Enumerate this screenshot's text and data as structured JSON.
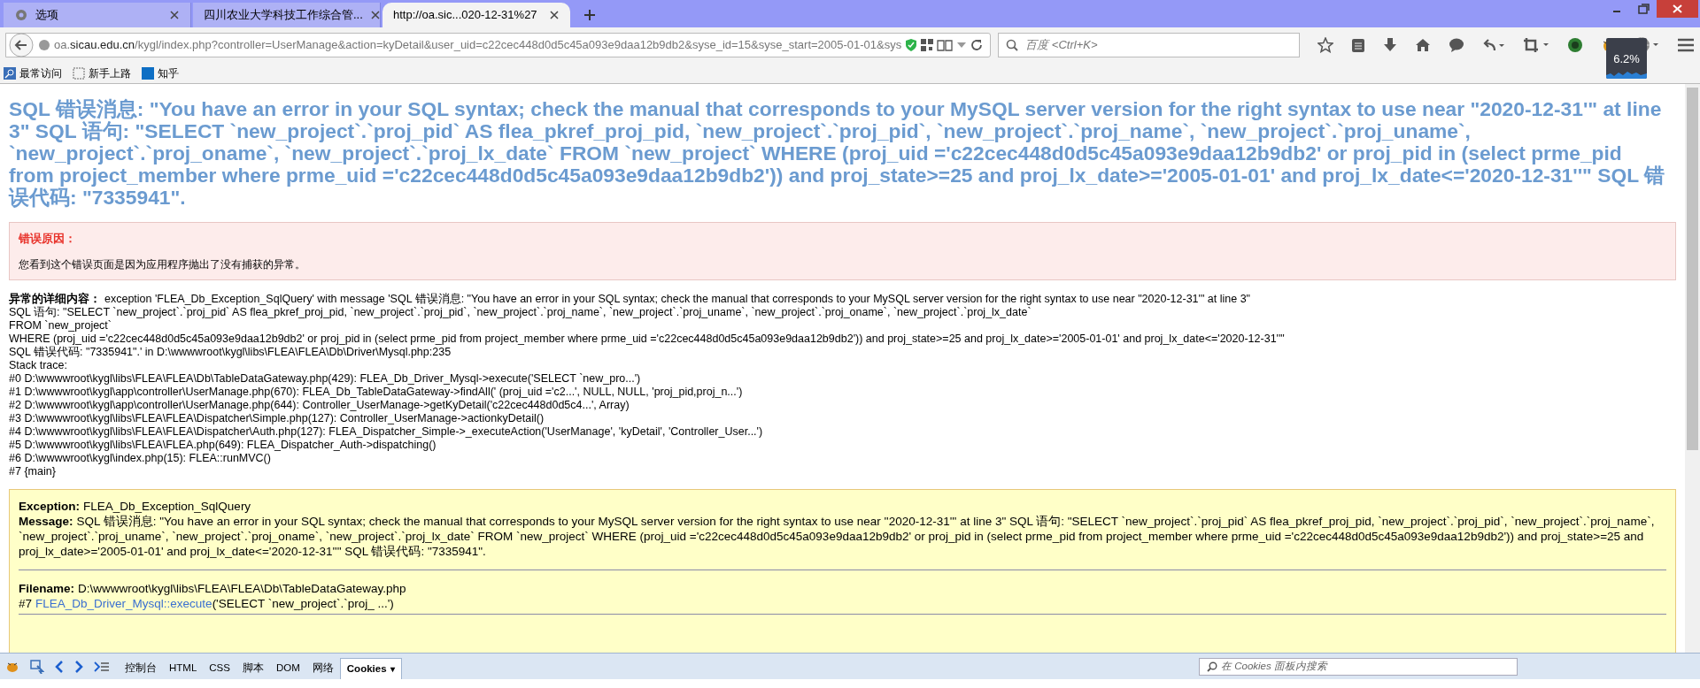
{
  "tabs": [
    {
      "label": "选项",
      "kind": "settings",
      "selected": false
    },
    {
      "label": "四川农业大学科技工作综合管...",
      "kind": "page",
      "selected": false
    },
    {
      "label": "http://oa.sic...020-12-31%27",
      "kind": "page",
      "selected": true
    }
  ],
  "address_bar": {
    "url": "oa.**sicau.edu.cn**/kygl/index.php?controller=UserManage&action=kyDetail&user_uid=c22cec448d0d5c45a093e9daa12b9db2&syse_id=15&syse_start=2005-01-01&sys"
  },
  "search": {
    "placeholder": "百度 <Ctrl+K>"
  },
  "cpu_meter": {
    "reading": "6.2%"
  },
  "bookmarks": [
    {
      "label": "最常访问",
      "kind": "search"
    },
    {
      "label": "新手上路",
      "kind": "blank"
    },
    {
      "label": "知乎",
      "kind": "zhihu"
    }
  ],
  "page": {
    "heading": "SQL 错误消息: \"You have an error in your SQL syntax; check the manual that corresponds to your MySQL server version for the right syntax to use near \"2020-12-31'\" at line 3\" SQL 语句: \"SELECT `new_project`.`proj_pid` AS flea_pkref_proj_pid, `new_project`.`proj_pid`, `new_project`.`proj_name`, `new_project`.`proj_uname`, `new_project`.`proj_oname`, `new_project`.`proj_lx_date` FROM `new_project` WHERE (proj_uid ='c22cec448d0d5c45a093e9daa12b9db2' or proj_pid in (select prme_pid from project_member where prme_uid ='c22cec448d0d5c45a093e9daa12b9db2')) and proj_state>=25 and proj_lx_date>='2005-01-01' and proj_lx_date<='2020-12-31''\" SQL 错误代码: \"7335941\".",
    "reason": {
      "title": "错误原因：",
      "text": "您看到这个错误页面是因为应用程序抛出了没有捕获的异常。"
    },
    "details": {
      "label": "异常的详细内容：",
      "lines": [
        "exception 'FLEA_Db_Exception_SqlQuery' with message 'SQL 错误消息: \"You have an error in your SQL syntax; check the manual that corresponds to your MySQL server version for the right syntax to use near \"2020-12-31'\" at line 3\"",
        "SQL 语句: \"SELECT `new_project`.`proj_pid` AS flea_pkref_proj_pid, `new_project`.`proj_pid`, `new_project`.`proj_name`, `new_project`.`proj_uname`, `new_project`.`proj_oname`, `new_project`.`proj_lx_date`",
        "FROM `new_project`",
        "WHERE  (proj_uid ='c22cec448d0d5c45a093e9daa12b9db2' or proj_pid in (select prme_pid from project_member where prme_uid ='c22cec448d0d5c45a093e9daa12b9db2')) and proj_state>=25 and proj_lx_date>='2005-01-01' and proj_lx_date<='2020-12-31''\"",
        "SQL 错误代码: \"7335941\".' in D:\\wwwwroot\\kygl\\libs\\FLEA\\FLEA\\Db\\Driver\\Mysql.php:235",
        "Stack trace:",
        "#0 D:\\wwwwroot\\kygl\\libs\\FLEA\\FLEA\\Db\\TableDataGateway.php(429): FLEA_Db_Driver_Mysql->execute('SELECT `new_pro...')",
        "#1 D:\\wwwwroot\\kygl\\app\\controller\\UserManage.php(670): FLEA_Db_TableDataGateway->findAll(' (proj_uid ='c2...', NULL, NULL, 'proj_pid,proj_n...')",
        "#2 D:\\wwwwroot\\kygl\\app\\controller\\UserManage.php(644): Controller_UserManage->getKyDetail('c22cec448d0d5c4...', Array)",
        "#3 D:\\wwwwroot\\kygl\\libs\\FLEA\\FLEA\\Dispatcher\\Simple.php(127): Controller_UserManage->actionkyDetail()",
        "#4 D:\\wwwwroot\\kygl\\libs\\FLEA\\FLEA\\Dispatcher\\Auth.php(127): FLEA_Dispatcher_Simple->_executeAction('UserManage', 'kyDetail', 'Controller_User...')",
        "#5 D:\\wwwwroot\\kygl\\libs\\FLEA\\FLEA.php(649): FLEA_Dispatcher_Auth->dispatching()",
        "#6 D:\\wwwwroot\\kygl\\index.php(15): FLEA::runMVC()",
        "#7 {main}"
      ]
    },
    "exception": {
      "exception_label": "Exception:",
      "exception": "FLEA_Db_Exception_SqlQuery",
      "message_label": "Message:",
      "message": "SQL 错误消息: \"You have an error in your SQL syntax; check the manual that corresponds to your MySQL server version for the right syntax to use near ''2020-12-31''' at line 3\" SQL 语句: \"SELECT `new_project`.`proj_pid` AS flea_pkref_proj_pid, `new_project`.`proj_pid`, `new_project`.`proj_name`, `new_project`.`proj_uname`, `new_project`.`proj_oname`, `new_project`.`proj_lx_date` FROM `new_project` WHERE (proj_uid ='c22cec448d0d5c45a093e9daa12b9db2' or proj_pid in (select prme_pid from project_member where prme_uid ='c22cec448d0d5c45a093e9daa12b9db2')) and proj_state>=25 and proj_lx_date>='2005-01-01' and proj_lx_date<='2020-12-31''\" SQL 错误代码: \"7335941\".",
      "filename_label": "Filename:",
      "filename": "D:\\wwwwroot\\kygl\\libs\\FLEA\\FLEA\\Db\\TableDataGateway.php",
      "frame_number": "#7",
      "frame_function": "FLEA_Db_Driver_Mysql::execute",
      "frame_args": "('SELECT `new_project`.`proj_ ...')"
    }
  },
  "devtools": {
    "tabs": [
      {
        "label": "控制台",
        "selected": false,
        "menu": false
      },
      {
        "label": "HTML",
        "selected": false,
        "menu": false
      },
      {
        "label": "CSS",
        "selected": false,
        "menu": false
      },
      {
        "label": "脚本",
        "selected": false,
        "menu": false
      },
      {
        "label": "DOM",
        "selected": false,
        "menu": false
      },
      {
        "label": "网络",
        "selected": false,
        "menu": false
      },
      {
        "label": "Cookies",
        "selected": true,
        "menu": true
      }
    ],
    "search": {
      "placeholder": "在 Cookies 面板内搜索"
    },
    "menu_caret": "▾"
  }
}
